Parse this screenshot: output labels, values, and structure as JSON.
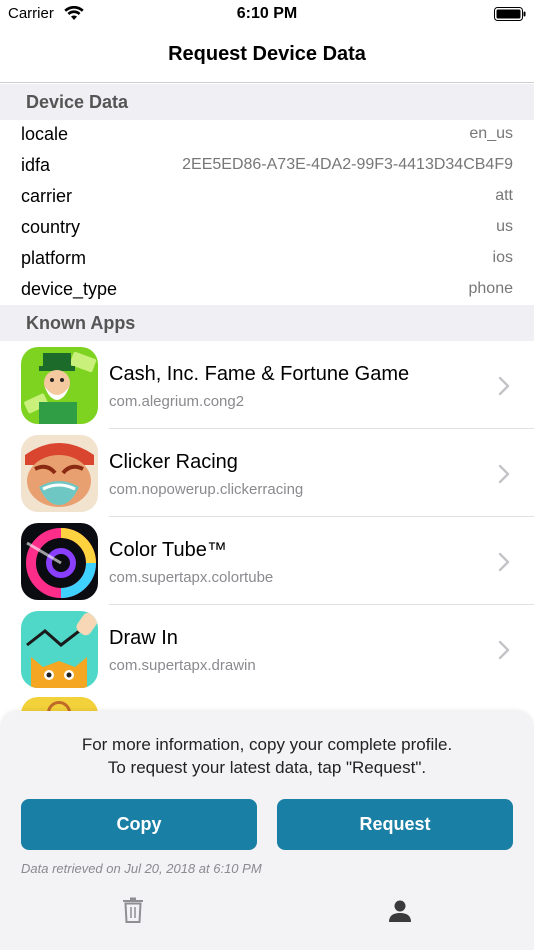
{
  "status_bar": {
    "carrier": "Carrier",
    "time": "6:10 PM"
  },
  "nav": {
    "title": "Request Device Data"
  },
  "device_data": {
    "header": "Device Data",
    "rows": [
      {
        "key": "locale",
        "value": "en_us"
      },
      {
        "key": "idfa",
        "value": "2EE5ED86-A73E-4DA2-99F3-4413D34CB4F9"
      },
      {
        "key": "carrier",
        "value": "att"
      },
      {
        "key": "country",
        "value": "us"
      },
      {
        "key": "platform",
        "value": "ios"
      },
      {
        "key": "device_type",
        "value": "phone"
      }
    ]
  },
  "known_apps": {
    "header": "Known Apps",
    "apps": [
      {
        "name": "Cash, Inc. Fame & Fortune Game",
        "bundle": "com.alegrium.cong2",
        "icon": "cash-inc-app-icon"
      },
      {
        "name": "Clicker Racing",
        "bundle": "com.nopowerup.clickerracing",
        "icon": "clicker-racing-app-icon"
      },
      {
        "name": "Color Tube™",
        "bundle": "com.supertapx.colortube",
        "icon": "color-tube-app-icon"
      },
      {
        "name": "Draw In",
        "bundle": "com.supertapx.drawin",
        "icon": "draw-in-app-icon"
      }
    ]
  },
  "panel": {
    "info_line1": "For more information, copy your complete profile.",
    "info_line2": "To request your latest data, tap \"Request\".",
    "copy_label": "Copy",
    "request_label": "Request",
    "retrieved": "Data retrieved on Jul 20, 2018 at 6:10 PM"
  },
  "colors": {
    "accent": "#1a7fa4",
    "section_bg": "#efeff4",
    "panel_bg": "#f3f3f5"
  }
}
